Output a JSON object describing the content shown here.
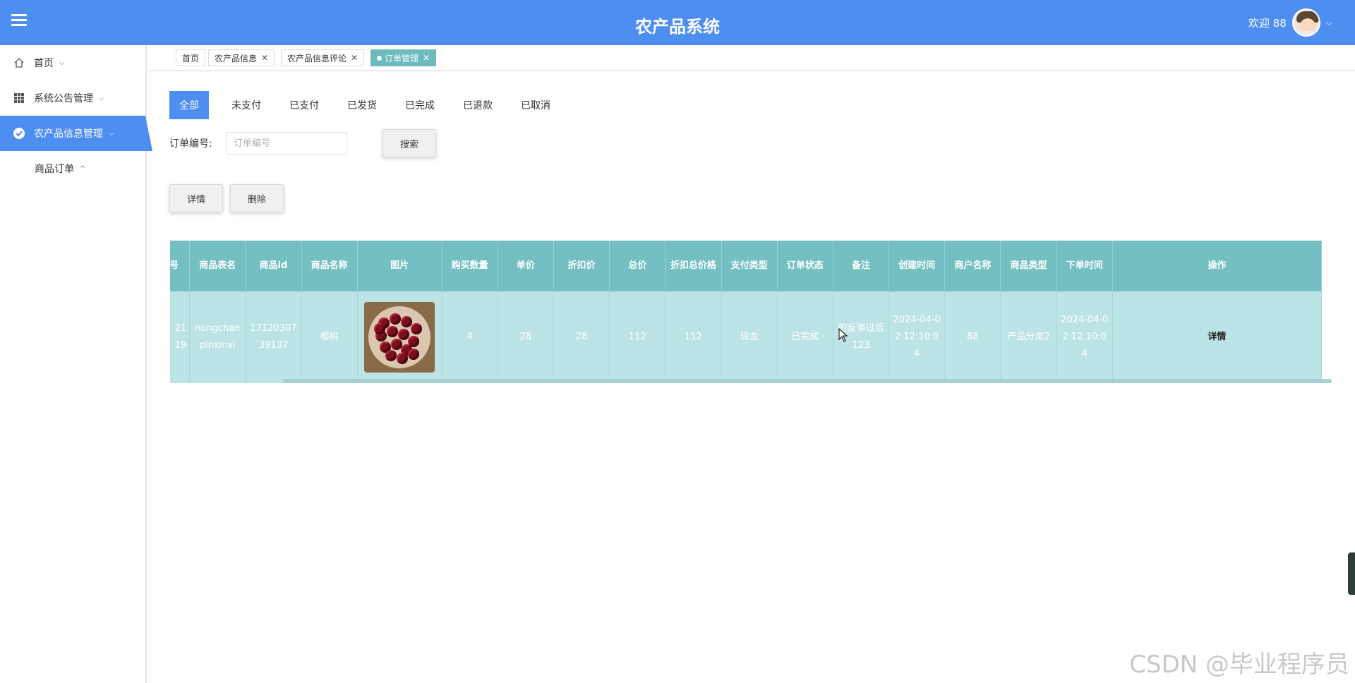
{
  "header": {
    "title": "农产品系统",
    "welcome": "欢迎 88"
  },
  "sidebar": {
    "items": [
      {
        "label": "首页",
        "icon": "home-icon"
      },
      {
        "label": "系统公告管理",
        "icon": "grid-icon"
      },
      {
        "label": "农产品信息管理",
        "icon": "check-circle-icon",
        "active": true
      }
    ],
    "subitem": {
      "label": "商品订单"
    }
  },
  "tabs": [
    {
      "label": "首页"
    },
    {
      "label": "农产品信息"
    },
    {
      "label": "农产品信息评论"
    },
    {
      "label": "订单管理",
      "active": true
    }
  ],
  "status_tabs": [
    "全部",
    "未支付",
    "已支付",
    "已发货",
    "已完成",
    "已退款",
    "已取消"
  ],
  "search": {
    "label": "订单编号:",
    "placeholder": "订单编号",
    "button": "搜索"
  },
  "actions": {
    "detail": "详情",
    "delete": "删除"
  },
  "table": {
    "headers": [
      "号",
      "商品表名",
      "商品id",
      "商品名称",
      "图片",
      "购买数量",
      "单价",
      "折扣价",
      "总价",
      "折扣总价格",
      "支付类型",
      "订单状态",
      "备注",
      "创建时间",
      "商户名称",
      "商品类型",
      "下单时间",
      "操作"
    ],
    "row": {
      "no": "21\n19",
      "table_name": "nongchanpinxinxi",
      "goods_id": "1712030739137",
      "goods_name": "樱桃",
      "qty": "4",
      "price": "28",
      "discount_price": "28",
      "total": "112",
      "discount_total": "112",
      "pay_type": "现金",
      "status": "已完成",
      "remark": "的反弹过后123",
      "create_time": "2024-04-02 12:10:04",
      "merchant": "88",
      "goods_type": "产品分类2",
      "order_time": "2024-04-02 12:10:04",
      "op": "详情"
    }
  },
  "watermark": "CSDN @毕业程序员",
  "colors": {
    "header": "#4d8ef0",
    "table_header": "#73bfc2",
    "table_row": "#bce3e5",
    "active_tab": "#6cbcbe"
  }
}
